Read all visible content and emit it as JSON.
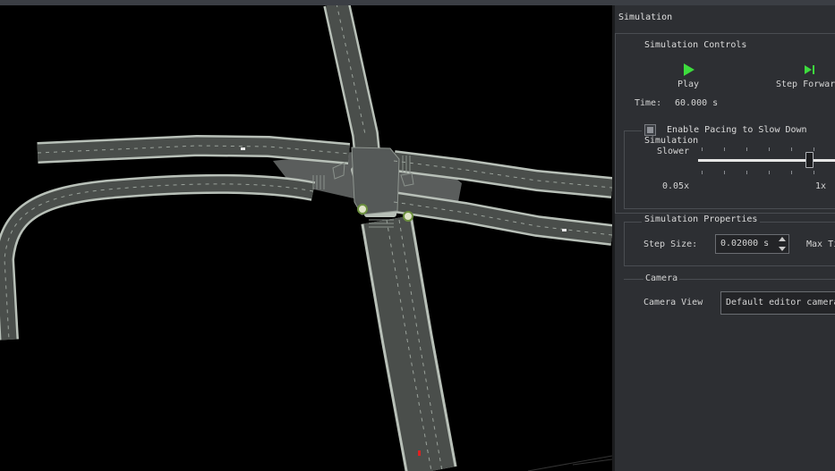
{
  "panel": {
    "title": "Simulation",
    "controls": {
      "legend": "Simulation Controls",
      "play_label": "Play",
      "step_label": "Step Forward",
      "time_label": "Time:",
      "time_value": "60.000 s"
    },
    "pacing": {
      "checkbox_label": "Enable Pacing to Slow Down Simulation",
      "checked": false,
      "slower_label": "Slower",
      "min_label": "0.05x",
      "max_label": "1x"
    },
    "properties": {
      "legend": "Simulation Properties",
      "step_size_label": "Step Size:",
      "step_size_value": "0.02000 s",
      "max_label": "Max Time"
    },
    "camera": {
      "legend": "Camera",
      "view_label": "Camera View",
      "view_value": "Default editor camera"
    }
  },
  "icons": {
    "play": "play-icon",
    "step": "step-forward-icon"
  },
  "colors": {
    "play_green": "#3ddc3d",
    "road": "#4a4e4b",
    "road_edge": "#b8c0b8",
    "viewport_bg": "#000000",
    "panel_bg": "#2d2f33"
  }
}
